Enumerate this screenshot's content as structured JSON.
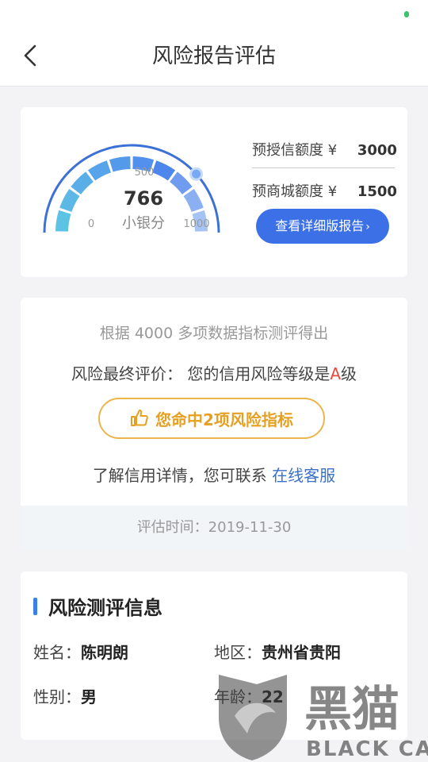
{
  "header": {
    "title": "风险报告评估"
  },
  "gauge": {
    "score": "766",
    "score_label": "小银分",
    "tick_min": "0",
    "tick_mid": "500",
    "tick_max": "1000",
    "value": 766,
    "max": 1000
  },
  "credit": {
    "pre_credit_label": "预授信额度 ¥",
    "pre_credit_value": "3000",
    "pre_mall_label": "预商城额度 ¥",
    "pre_mall_value": "1500",
    "detail_button": "查看详细版报告",
    "chevron": "›"
  },
  "assessment": {
    "basis": "根据 4000 多项数据指标测评得出",
    "final_prefix": "风险最终评价：  您的信用风险等级是",
    "grade": "A",
    "grade_suffix": "级",
    "hit_button": "您命中2项风险指标",
    "contact_prefix": "了解信用详情，您可联系 ",
    "contact_link": "在线客服",
    "eval_time": "评估时间：2019-11-30"
  },
  "info": {
    "section_title": "风险测评信息",
    "name_label": "姓名：",
    "name_value": "陈明朗",
    "region_label": "地区：",
    "region_value": "贵州省贵阳",
    "gender_label": "性别：",
    "gender_value": "男",
    "age_label": "年龄：",
    "age_value": "22"
  },
  "watermark": {
    "cn": "黑猫",
    "en": "BLACK CAT"
  },
  "colors": {
    "accent": "#3b70e6",
    "gold": "#e5a021",
    "grade_red": "#e84a3c"
  }
}
